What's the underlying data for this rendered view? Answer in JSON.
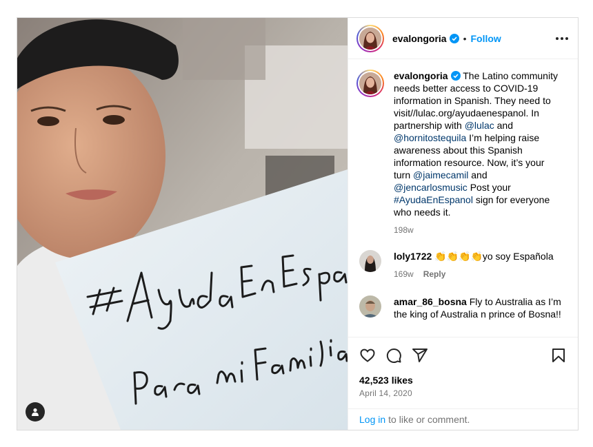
{
  "post": {
    "username": "evalongoria",
    "follow_label": "Follow",
    "separator": "•"
  },
  "caption": {
    "username": "evalongoria",
    "segments": [
      {
        "text": " The Latino community needs better access to COVID-19 information in Spanish. They need to visit//lulac.org/ayudaenespanol. In partnership with ",
        "link": false
      },
      {
        "text": "@lulac",
        "link": true
      },
      {
        "text": " and ",
        "link": false
      },
      {
        "text": "@hornitostequila",
        "link": true
      },
      {
        "text": " I’m helping raise awareness about this Spanish information resource. Now, it’s your turn ",
        "link": false
      },
      {
        "text": "@jaimecamil",
        "link": true
      },
      {
        "text": " and ",
        "link": false
      },
      {
        "text": "@jencarlosmusic",
        "link": true
      },
      {
        "text": " Post your ",
        "link": false
      },
      {
        "text": "#AyudaEnEspanol",
        "link": true
      },
      {
        "text": " sign for everyone who needs it.",
        "link": false
      }
    ],
    "time": "198w"
  },
  "comments": [
    {
      "username": "loly1722",
      "text": " 👏👏👏👏yo soy Española",
      "time": "169w",
      "reply_label": "Reply"
    },
    {
      "username": "amar_86_bosna",
      "text": " Fly to Australia as I’m the king of Australia n prince of Bosna!!",
      "time": "",
      "reply_label": ""
    }
  ],
  "icons": [
    "heart-icon",
    "comment-icon",
    "share-icon",
    "bookmark-icon",
    "more-icon",
    "verified-icon",
    "user-tag-icon"
  ],
  "likes": "42,523 likes",
  "date": "April 14, 2020",
  "footer": {
    "login_label": "Log in",
    "rest": "to like or comment."
  },
  "photo": {
    "sign_hashtag": "#AyudaEnEspañol",
    "sign_sub": "Para mi Familia"
  },
  "colors": {
    "accent": "#0095f6",
    "link": "#00376b",
    "muted": "#737373",
    "border": "#dbdbdb"
  }
}
